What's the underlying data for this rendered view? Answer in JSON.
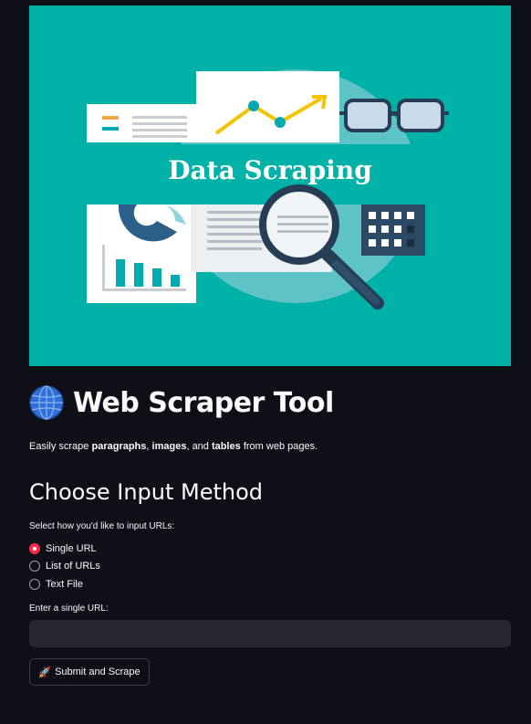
{
  "hero": {
    "banner_text": "Data Scraping",
    "background_color": "#00b1a8"
  },
  "header": {
    "icon": "globe-icon",
    "title": "Web Scraper Tool",
    "subtitle_parts": [
      "Easily scrape ",
      "paragraphs",
      ", ",
      "images",
      ", and ",
      "tables",
      " from web pages."
    ]
  },
  "input_method": {
    "heading": "Choose Input Method",
    "prompt": "Select how you'd like to input URLs:",
    "options": [
      "Single URL",
      "List of URLs",
      "Text File"
    ],
    "selected": "Single URL"
  },
  "url_field": {
    "label": "Enter a single URL:",
    "value": "",
    "placeholder": ""
  },
  "submit": {
    "icon": "rocket-icon",
    "label": "Submit and Scrape"
  },
  "colors": {
    "accent": "#ff2b4b",
    "background": "#0f1017",
    "input_bg": "#262730"
  }
}
